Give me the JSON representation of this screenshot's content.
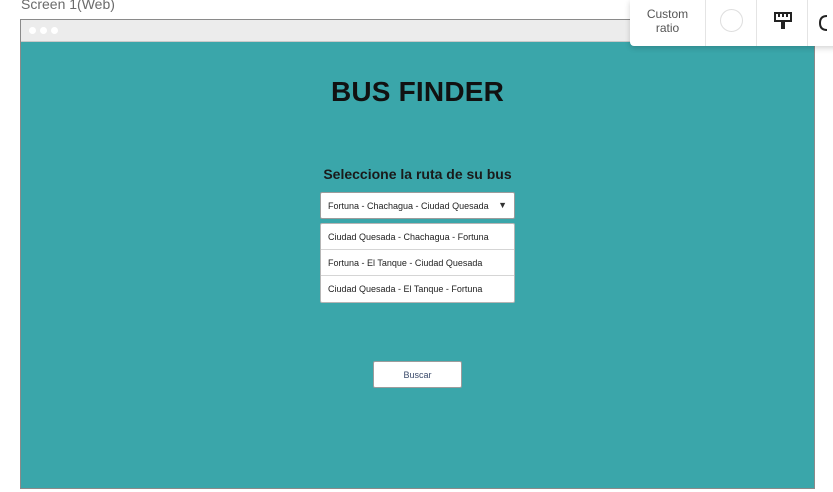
{
  "screen": {
    "label": "Screen 1(Web)"
  },
  "app": {
    "title": "BUS FINDER",
    "subtitle": "Seleccione la ruta de su bus"
  },
  "route_select": {
    "selected": "Fortuna - Chachagua - Ciudad Quesada",
    "options": [
      "Ciudad Quesada - Chachagua - Fortuna",
      "Fortuna - El Tanque - Ciudad Quesada",
      "Ciudad Quesada - El Tanque - Fortuna"
    ]
  },
  "search_button": {
    "label": "Buscar"
  },
  "toolbar": {
    "ratio_label_line1": "Custom",
    "ratio_label_line2": "ratio"
  },
  "colors": {
    "canvas": "#3aa6aa",
    "frame_bar": "#ececec"
  }
}
